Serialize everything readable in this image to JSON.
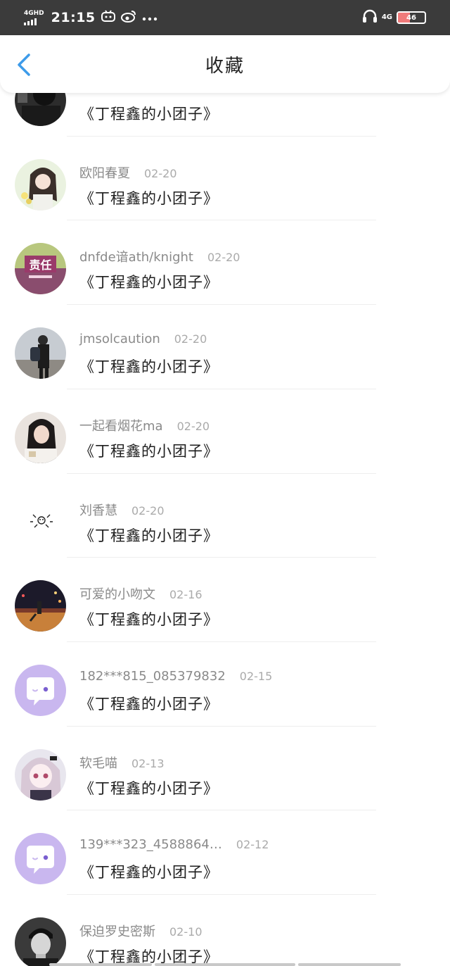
{
  "status_bar": {
    "network_label": "4GHD",
    "time": "21:15",
    "network_right": "4G",
    "battery": "46",
    "battery_level": 0.46,
    "icons": [
      "bilibili-icon",
      "weibo-icon",
      "more-dots-icon",
      "headphones-icon",
      "battery-icon"
    ]
  },
  "nav": {
    "back_icon": "chevron-left-icon",
    "title": "收藏",
    "accent_color": "#3d9be9"
  },
  "items": [
    {
      "user": "",
      "date": "",
      "message": "《丁程鑫的小团子》",
      "avatar": "dark-photo"
    },
    {
      "user": "欧阳春夏",
      "date": "02-20",
      "message": "《丁程鑫的小团子》",
      "avatar": "girl-illustration"
    },
    {
      "user": "dnfde谙ath/knight",
      "date": "02-20",
      "message": "《丁程鑫的小团子》",
      "avatar": "text-责任",
      "avatar_text": "责任"
    },
    {
      "user": "jmsolcaution",
      "date": "02-20",
      "message": "《丁程鑫的小团子》",
      "avatar": "person-backpack"
    },
    {
      "user": "一起看烟花ma",
      "date": "02-20",
      "message": "《丁程鑫的小团子》",
      "avatar": "girl-photo"
    },
    {
      "user": "刘香慧",
      "date": "02-20",
      "message": "《丁程鑫的小团子》",
      "avatar": "doodle"
    },
    {
      "user": "可爱的小吻文",
      "date": "02-16",
      "message": "《丁程鑫的小团子》",
      "avatar": "night-street"
    },
    {
      "user": "182***815_085379832",
      "date": "02-15",
      "message": "《丁程鑫的小团子》",
      "avatar": "default-chat"
    },
    {
      "user": "软毛喵",
      "date": "02-13",
      "message": "《丁程鑫的小团子》",
      "avatar": "anime-girl"
    },
    {
      "user": "139***323_4588864…",
      "date": "02-12",
      "message": "《丁程鑫的小团子》",
      "avatar": "default-chat"
    },
    {
      "user": "保迫罗史密斯",
      "date": "02-10",
      "message": "《丁程鑫的小团子》",
      "avatar": "man-bw"
    }
  ]
}
